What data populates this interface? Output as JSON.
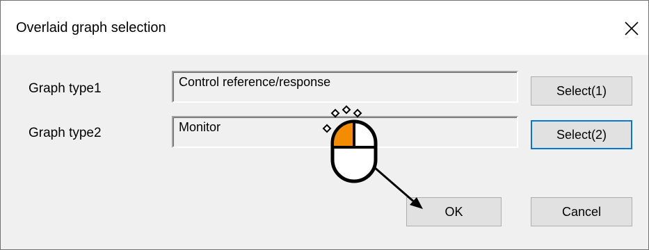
{
  "dialog": {
    "title": "Overlaid graph selection",
    "close_icon": "close-icon"
  },
  "rows": [
    {
      "label": "Graph type1",
      "value": "Control reference/response",
      "button": "Select(1)"
    },
    {
      "label": "Graph type2",
      "value": "Monitor",
      "button": "Select(2)"
    }
  ],
  "footer": {
    "ok_label": "OK",
    "cancel_label": "Cancel"
  },
  "annotation": {
    "icon": "mouse-click-icon",
    "button_highlight_color": "#f28c00",
    "arrow_target": "OK"
  },
  "colors": {
    "focus_border": "#0078d7",
    "dialog_bg": "#f0f0f0",
    "button_bg": "#e1e1e1"
  }
}
